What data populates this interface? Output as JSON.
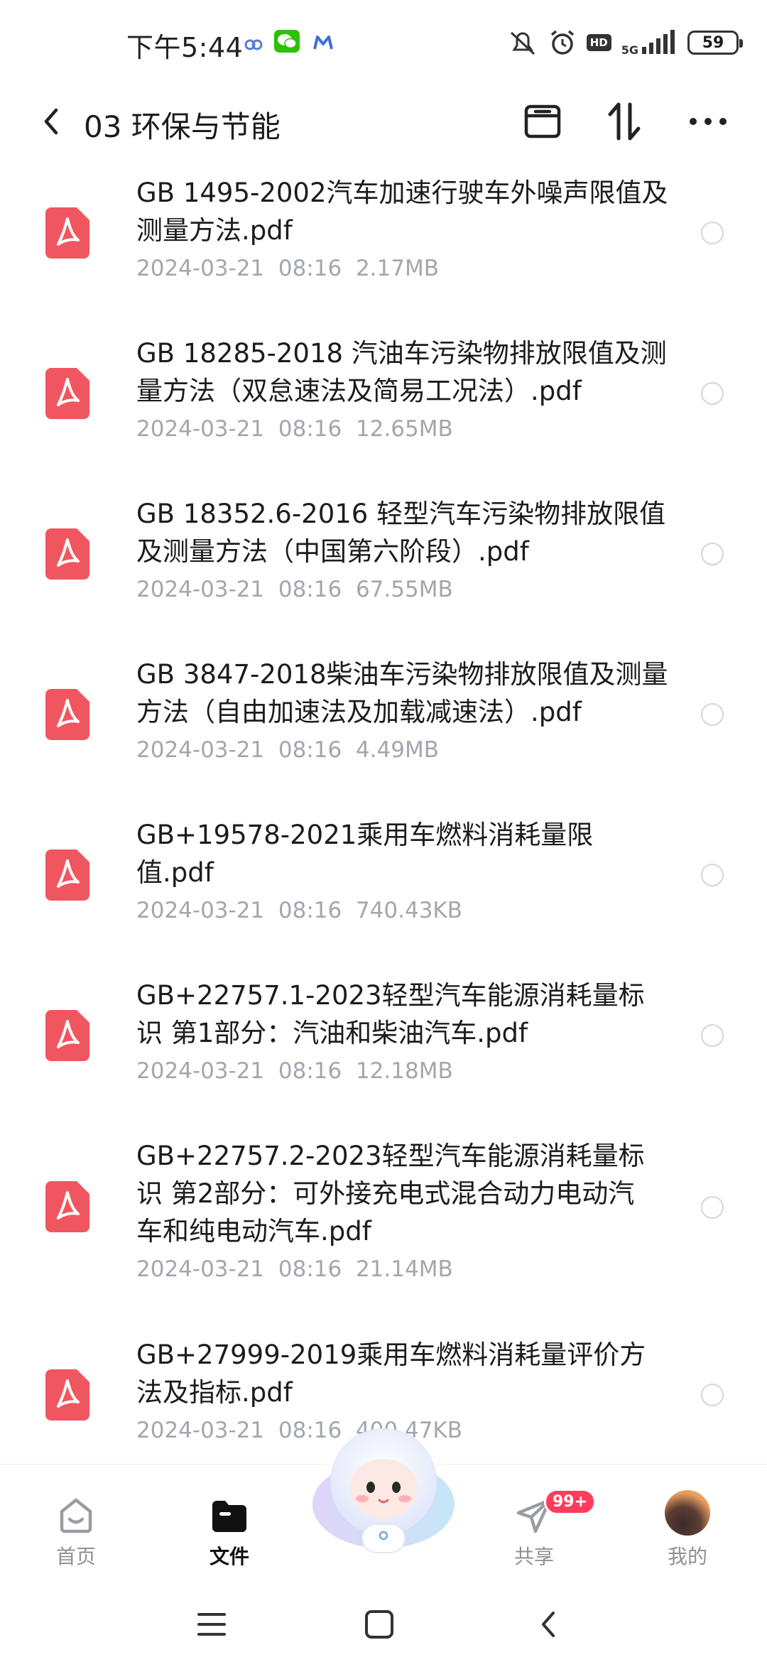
{
  "status_bar": {
    "time": "下午5:44",
    "network": "5G",
    "hd": "HD",
    "battery": "59"
  },
  "header": {
    "title": "03 环保与节能"
  },
  "files": [
    {
      "name": "GB 1495-2002汽车加速行驶车外噪声限值及测量方法.pdf",
      "date": "2024-03-21",
      "time": "08:16",
      "size": "2.17MB"
    },
    {
      "name": "GB 18285-2018 汽油车污染物排放限值及测量方法（双怠速法及简易工况法）.pdf",
      "date": "2024-03-21",
      "time": "08:16",
      "size": "12.65MB"
    },
    {
      "name": "GB 18352.6-2016 轻型汽车污染物排放限值及测量方法（中国第六阶段）.pdf",
      "date": "2024-03-21",
      "time": "08:16",
      "size": "67.55MB"
    },
    {
      "name": "GB 3847-2018柴油车污染物排放限值及测量方法（自由加速法及加载减速法）.pdf",
      "date": "2024-03-21",
      "time": "08:16",
      "size": "4.49MB"
    },
    {
      "name": "GB+19578-2021乘用车燃料消耗量限值.pdf",
      "date": "2024-03-21",
      "time": "08:16",
      "size": "740.43KB"
    },
    {
      "name": "GB+22757.1-2023轻型汽车能源消耗量标识 第1部分：汽油和柴油汽车.pdf",
      "date": "2024-03-21",
      "time": "08:16",
      "size": "12.18MB"
    },
    {
      "name": "GB+22757.2-2023轻型汽车能源消耗量标识 第2部分：可外接充电式混合动力电动汽车和纯电动汽车.pdf",
      "date": "2024-03-21",
      "time": "08:16",
      "size": "21.14MB"
    },
    {
      "name": "GB+27999-2019乘用车燃料消耗量评价方法及指标.pdf",
      "date": "2024-03-21",
      "time": "08:16",
      "size": "400.47KB"
    }
  ],
  "tabs": [
    {
      "label": "首页",
      "icon": "home-icon"
    },
    {
      "label": "文件",
      "icon": "folder-icon"
    },
    {
      "label": "共享",
      "icon": "share-icon",
      "badge": "99+"
    },
    {
      "label": "我的",
      "icon": "avatar"
    }
  ],
  "colors": {
    "pdf_icon": "#f0565f",
    "meta_text": "#a3a6ad",
    "badge": "#ff3d5a"
  }
}
